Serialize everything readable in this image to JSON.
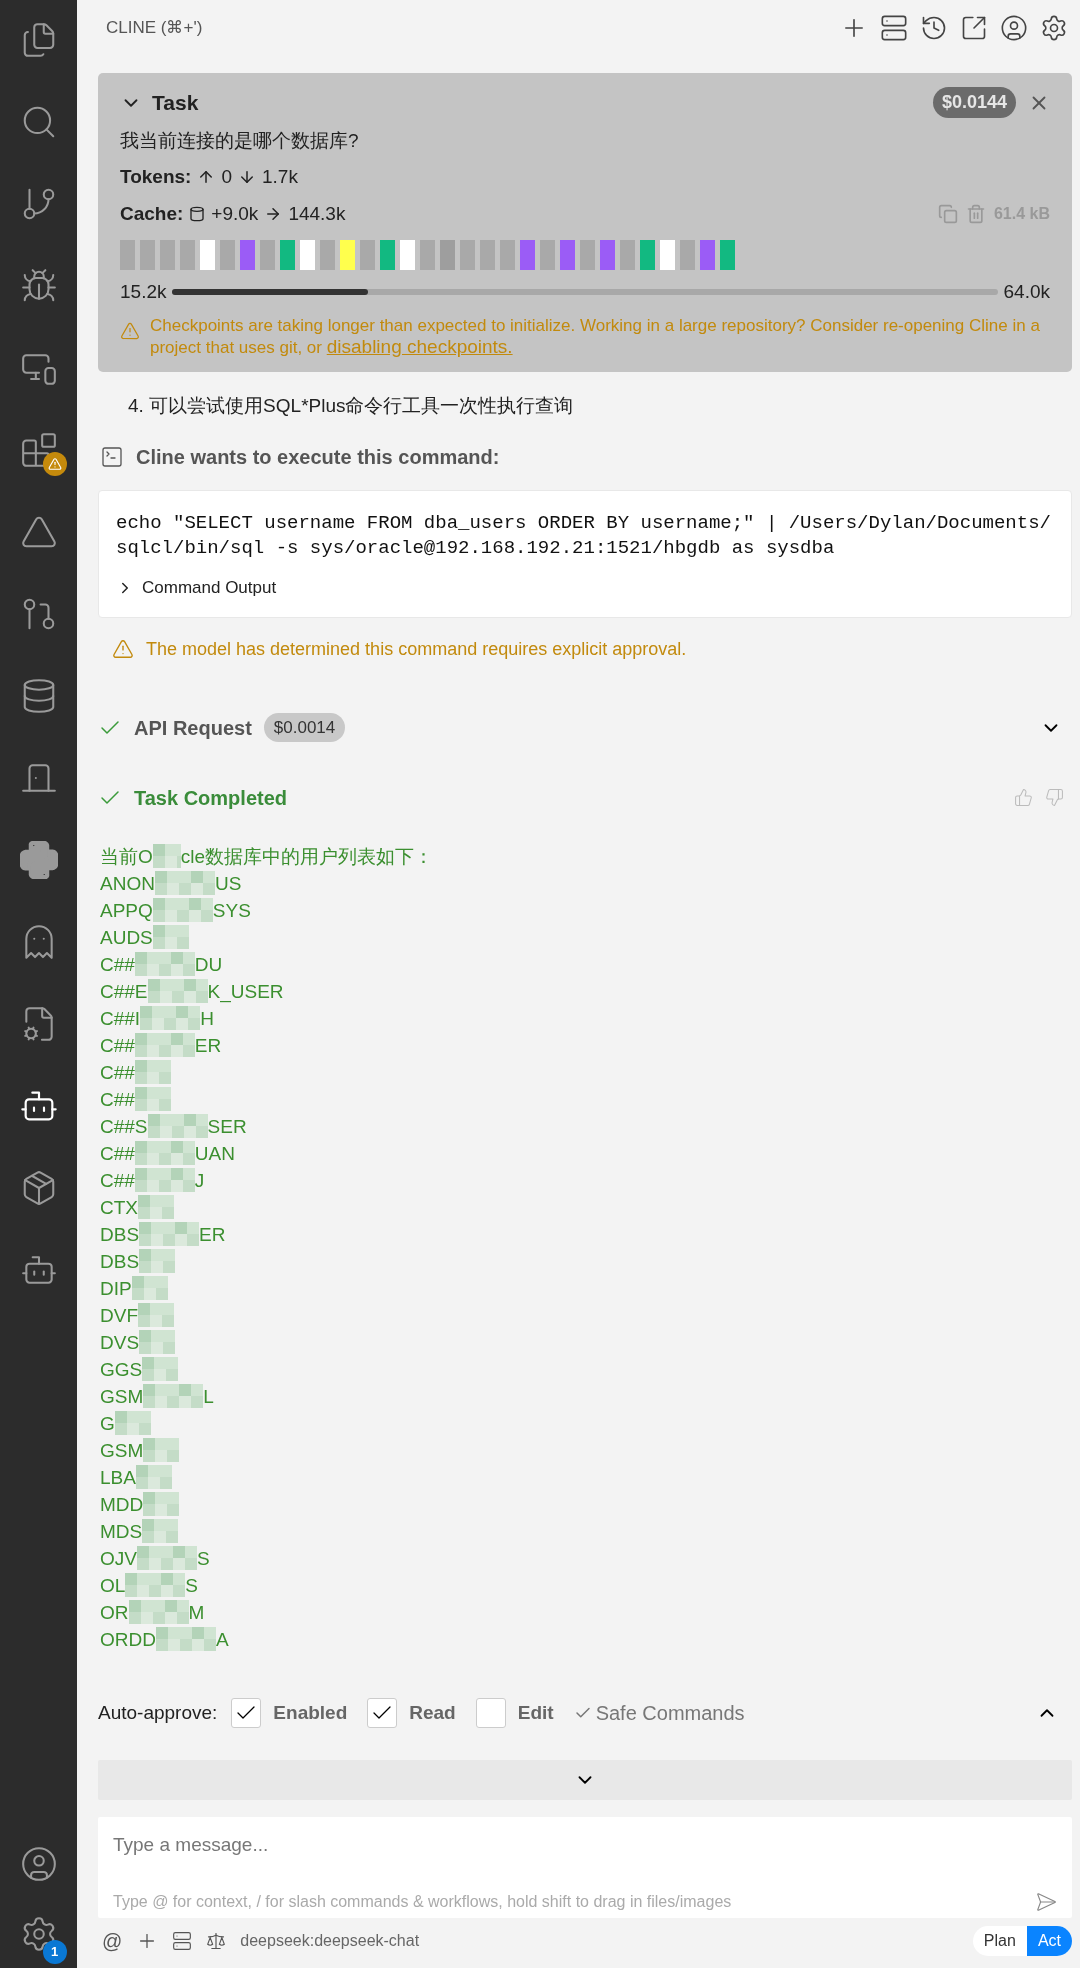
{
  "activity_bar": {
    "items": [
      {
        "kind": "files",
        "selected": false
      },
      {
        "kind": "search",
        "selected": false
      },
      {
        "kind": "branch",
        "selected": false
      },
      {
        "kind": "debug",
        "selected": false
      },
      {
        "kind": "remote",
        "selected": false
      },
      {
        "kind": "extensions",
        "selected": false,
        "warning": true
      },
      {
        "kind": "triangle",
        "selected": false
      },
      {
        "kind": "pull",
        "selected": false
      },
      {
        "kind": "database",
        "selected": false
      },
      {
        "kind": "door",
        "selected": false
      },
      {
        "kind": "python",
        "selected": false
      },
      {
        "kind": "alien",
        "selected": false
      },
      {
        "kind": "filecog",
        "selected": false
      },
      {
        "kind": "cline",
        "selected": true
      },
      {
        "kind": "package",
        "selected": false
      },
      {
        "kind": "robot",
        "selected": false
      }
    ],
    "settings_badge": "1"
  },
  "header": {
    "title": "CLINE (⌘+')"
  },
  "task": {
    "title": "Task",
    "expanded": true,
    "cost": "$0.0144",
    "question": "我当前连接的是哪个数据库?",
    "tokens_label": "Tokens:",
    "tokens_up": "0",
    "tokens_down": "1.7k",
    "cache_label": "Cache:",
    "cache_write": "+9.0k",
    "cache_read": "144.3k",
    "size": "61.4 kB",
    "blocks": [
      {
        "color": "#a9a9a9"
      },
      {
        "color": "#a9a9a9"
      },
      {
        "color": "#a9a9a9"
      },
      {
        "color": "#a9a9a9"
      },
      {
        "color": "#ffffff"
      },
      {
        "color": "#a9a9a9"
      },
      {
        "color": "#9b5cf6"
      },
      {
        "color": "#a9a9a9"
      },
      {
        "color": "#12b981"
      },
      {
        "color": "#ffffff"
      },
      {
        "color": "#a9a9a9"
      },
      {
        "color": "#ffff4d"
      },
      {
        "color": "#a9a9a9"
      },
      {
        "color": "#12b981"
      },
      {
        "color": "#ffffff"
      },
      {
        "color": "#a9a9a9"
      },
      {
        "color": "#9e9e9e"
      },
      {
        "color": "#a9a9a9"
      },
      {
        "color": "#a9a9a9"
      },
      {
        "color": "#a9a9a9"
      },
      {
        "color": "#9b5cf6"
      },
      {
        "color": "#a9a9a9"
      },
      {
        "color": "#9b5cf6"
      },
      {
        "color": "#a9a9a9"
      },
      {
        "color": "#9b5cf6"
      },
      {
        "color": "#a9a9a9"
      },
      {
        "color": "#12b981"
      },
      {
        "color": "#ffffff"
      },
      {
        "color": "#a9a9a9"
      },
      {
        "color": "#9b5cf6"
      },
      {
        "color": "#12b981"
      }
    ],
    "context_used": "15.2k",
    "context_max": "64.0k",
    "level": 0.237,
    "warning": "Checkpoints are taking longer than expected to initialize. Working in a large repository? Consider re-opening Cline in a project that uses git, or",
    "warning_link": "disabling checkpoints."
  },
  "step": "4. 可以尝试使用SQL*Plus命令行工具一次性执行查询",
  "command": {
    "title": "Cline wants to execute this command:",
    "code": "echo \"SELECT username FROM dba_users ORDER BY username;\" | /Users/Dylan/Documents/sqlcl/bin/sql -s sys/oracle@192.168.192.21:1521/hbgdb as sysdba",
    "output_label": "Command Output",
    "output_expanded": false,
    "warning": "The model has determined this command requires explicit approval."
  },
  "api_request": {
    "title": "API Request",
    "cost": "$0.0014",
    "expanded": false
  },
  "completed": {
    "title": "Task Completed"
  },
  "result": {
    "heading": {
      "start": "当前O",
      "end": "cle数据库中的用户列表如下："
    },
    "rows": [
      {
        "start": "ANON",
        "end": "US"
      },
      {
        "start": "APPQ",
        "end": "SYS"
      },
      {
        "start": "AUDS"
      },
      {
        "start": "C##",
        "end": "DU"
      },
      {
        "start": "C##E",
        "end": "K_USER"
      },
      {
        "start": "C##I",
        "end": "H"
      },
      {
        "start": "C##",
        "end": "ER"
      },
      {
        "start": "C##"
      },
      {
        "start": "C##"
      },
      {
        "start": "C##S",
        "end": "SER"
      },
      {
        "start": "C##",
        "end": "UAN"
      },
      {
        "start": "C##",
        "end": "J"
      },
      {
        "start": "CTX"
      },
      {
        "start": "DBS",
        "end": "ER"
      },
      {
        "start": "DBS"
      },
      {
        "start": "DIP"
      },
      {
        "start": "DVF"
      },
      {
        "start": "DVS"
      },
      {
        "start": "GGS"
      },
      {
        "start": "GSM",
        "end": "L"
      },
      {
        "start": "G"
      },
      {
        "start": "GSM"
      },
      {
        "start": "LBA"
      },
      {
        "start": "MDD"
      },
      {
        "start": "MDS"
      },
      {
        "start": "OJV",
        "end": "S"
      },
      {
        "start": "OL",
        "end": "S"
      },
      {
        "start": "OR",
        "end": "M"
      },
      {
        "start": "ORDD",
        "end": "A"
      }
    ]
  },
  "auto_approve": {
    "label": "Auto-approve:",
    "expanded": false,
    "items": [
      {
        "kind": "checkbox",
        "label": "Enabled",
        "checked": true
      },
      {
        "kind": "checkbox",
        "label": "Read",
        "checked": true
      },
      {
        "kind": "checkbox",
        "label": "Edit",
        "checked": false
      },
      {
        "kind": "tick",
        "label": "Safe Commands",
        "checked": true
      }
    ]
  },
  "input": {
    "placeholder": "Type a message...",
    "hint": "Type @ for context, / for slash commands & workflows, hold shift to drag in files/images"
  },
  "footer": {
    "at": "@",
    "model": "deepseek:deepseek-chat",
    "modes": [
      {
        "label": "Plan",
        "selected": false
      },
      {
        "label": "Act",
        "selected": true
      }
    ]
  }
}
